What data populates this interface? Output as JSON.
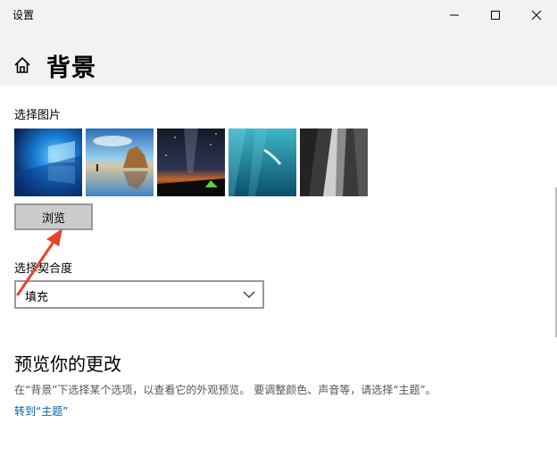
{
  "window": {
    "title": "设置"
  },
  "header": {
    "title": "背景",
    "home_icon": "home-icon"
  },
  "picture_section": {
    "label": "选择图片",
    "thumbnails": [
      {
        "name": "windows-logo"
      },
      {
        "name": "beach-rocks"
      },
      {
        "name": "night-sky-tent"
      },
      {
        "name": "underwater-swimmer"
      },
      {
        "name": "rock-cliff"
      }
    ],
    "browse_label": "浏览"
  },
  "fit_section": {
    "label": "选择契合度",
    "selected": "填充"
  },
  "preview_section": {
    "title": "预览你的更改",
    "description": "在“背景”下选择某个选项，以查看它的外观预览。 要调整颜色、声音等，请选择“主题”。",
    "link": "转到“主题”"
  },
  "colors": {
    "titlebar_bg": "#f2f2f2",
    "link": "#0063b1",
    "annotation_arrow": "#e8432e"
  }
}
